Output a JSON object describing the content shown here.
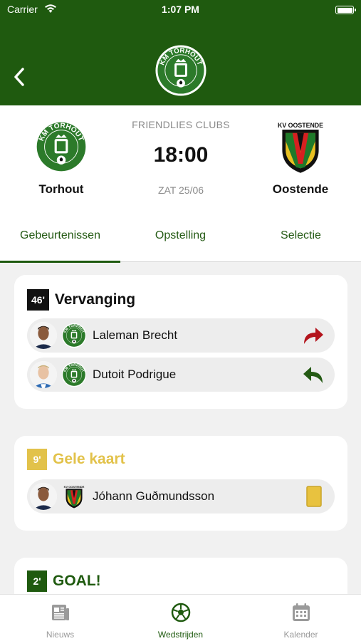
{
  "status_bar": {
    "carrier": "Carrier",
    "time": "1:07 PM"
  },
  "colors": {
    "header_green": "#1f5a0f",
    "tab_green": "#245a14",
    "yellow": "#e2c24a",
    "substitution_out_red": "#b3141c",
    "substitution_in_green": "#245a14",
    "minute_black": "#111111",
    "goal_green": "#1f5a0f"
  },
  "match": {
    "competition": "FRIENDLIES CLUBS",
    "kickoff_time": "18:00",
    "date": "ZAT 25/06",
    "home_team": {
      "name": "Torhout",
      "logo": "km-torhout-crest"
    },
    "away_team": {
      "name": "Oostende",
      "logo": "kv-oostende-shield"
    }
  },
  "tabs": [
    {
      "label": "Gebeurtenissen",
      "active": true
    },
    {
      "label": "Opstelling",
      "active": false
    },
    {
      "label": "Selectie",
      "active": false
    }
  ],
  "events": [
    {
      "minute": "46'",
      "title": "Vervanging",
      "type": "substitution",
      "players": [
        {
          "name": "Laleman Brecht",
          "club": "km-torhout-crest",
          "icon": "substitution-out-arrow-icon"
        },
        {
          "name": "Dutoit Podrigue",
          "club": "km-torhout-crest",
          "icon": "substitution-in-arrow-icon"
        }
      ]
    },
    {
      "minute": "9'",
      "title": "Gele kaart",
      "type": "yellow_card",
      "players": [
        {
          "name": "Jóhann Guðmundsson",
          "club": "kv-oostende-shield",
          "icon": "yellow-card-icon"
        }
      ]
    },
    {
      "minute": "2'",
      "title": "GOAL!",
      "type": "goal",
      "players": []
    }
  ],
  "bottom_nav": [
    {
      "label": "Nieuws",
      "icon": "newspaper-icon",
      "active": false
    },
    {
      "label": "Wedstrijden",
      "icon": "soccer-ball-icon",
      "active": true
    },
    {
      "label": "Kalender",
      "icon": "calendar-icon",
      "active": false
    }
  ]
}
